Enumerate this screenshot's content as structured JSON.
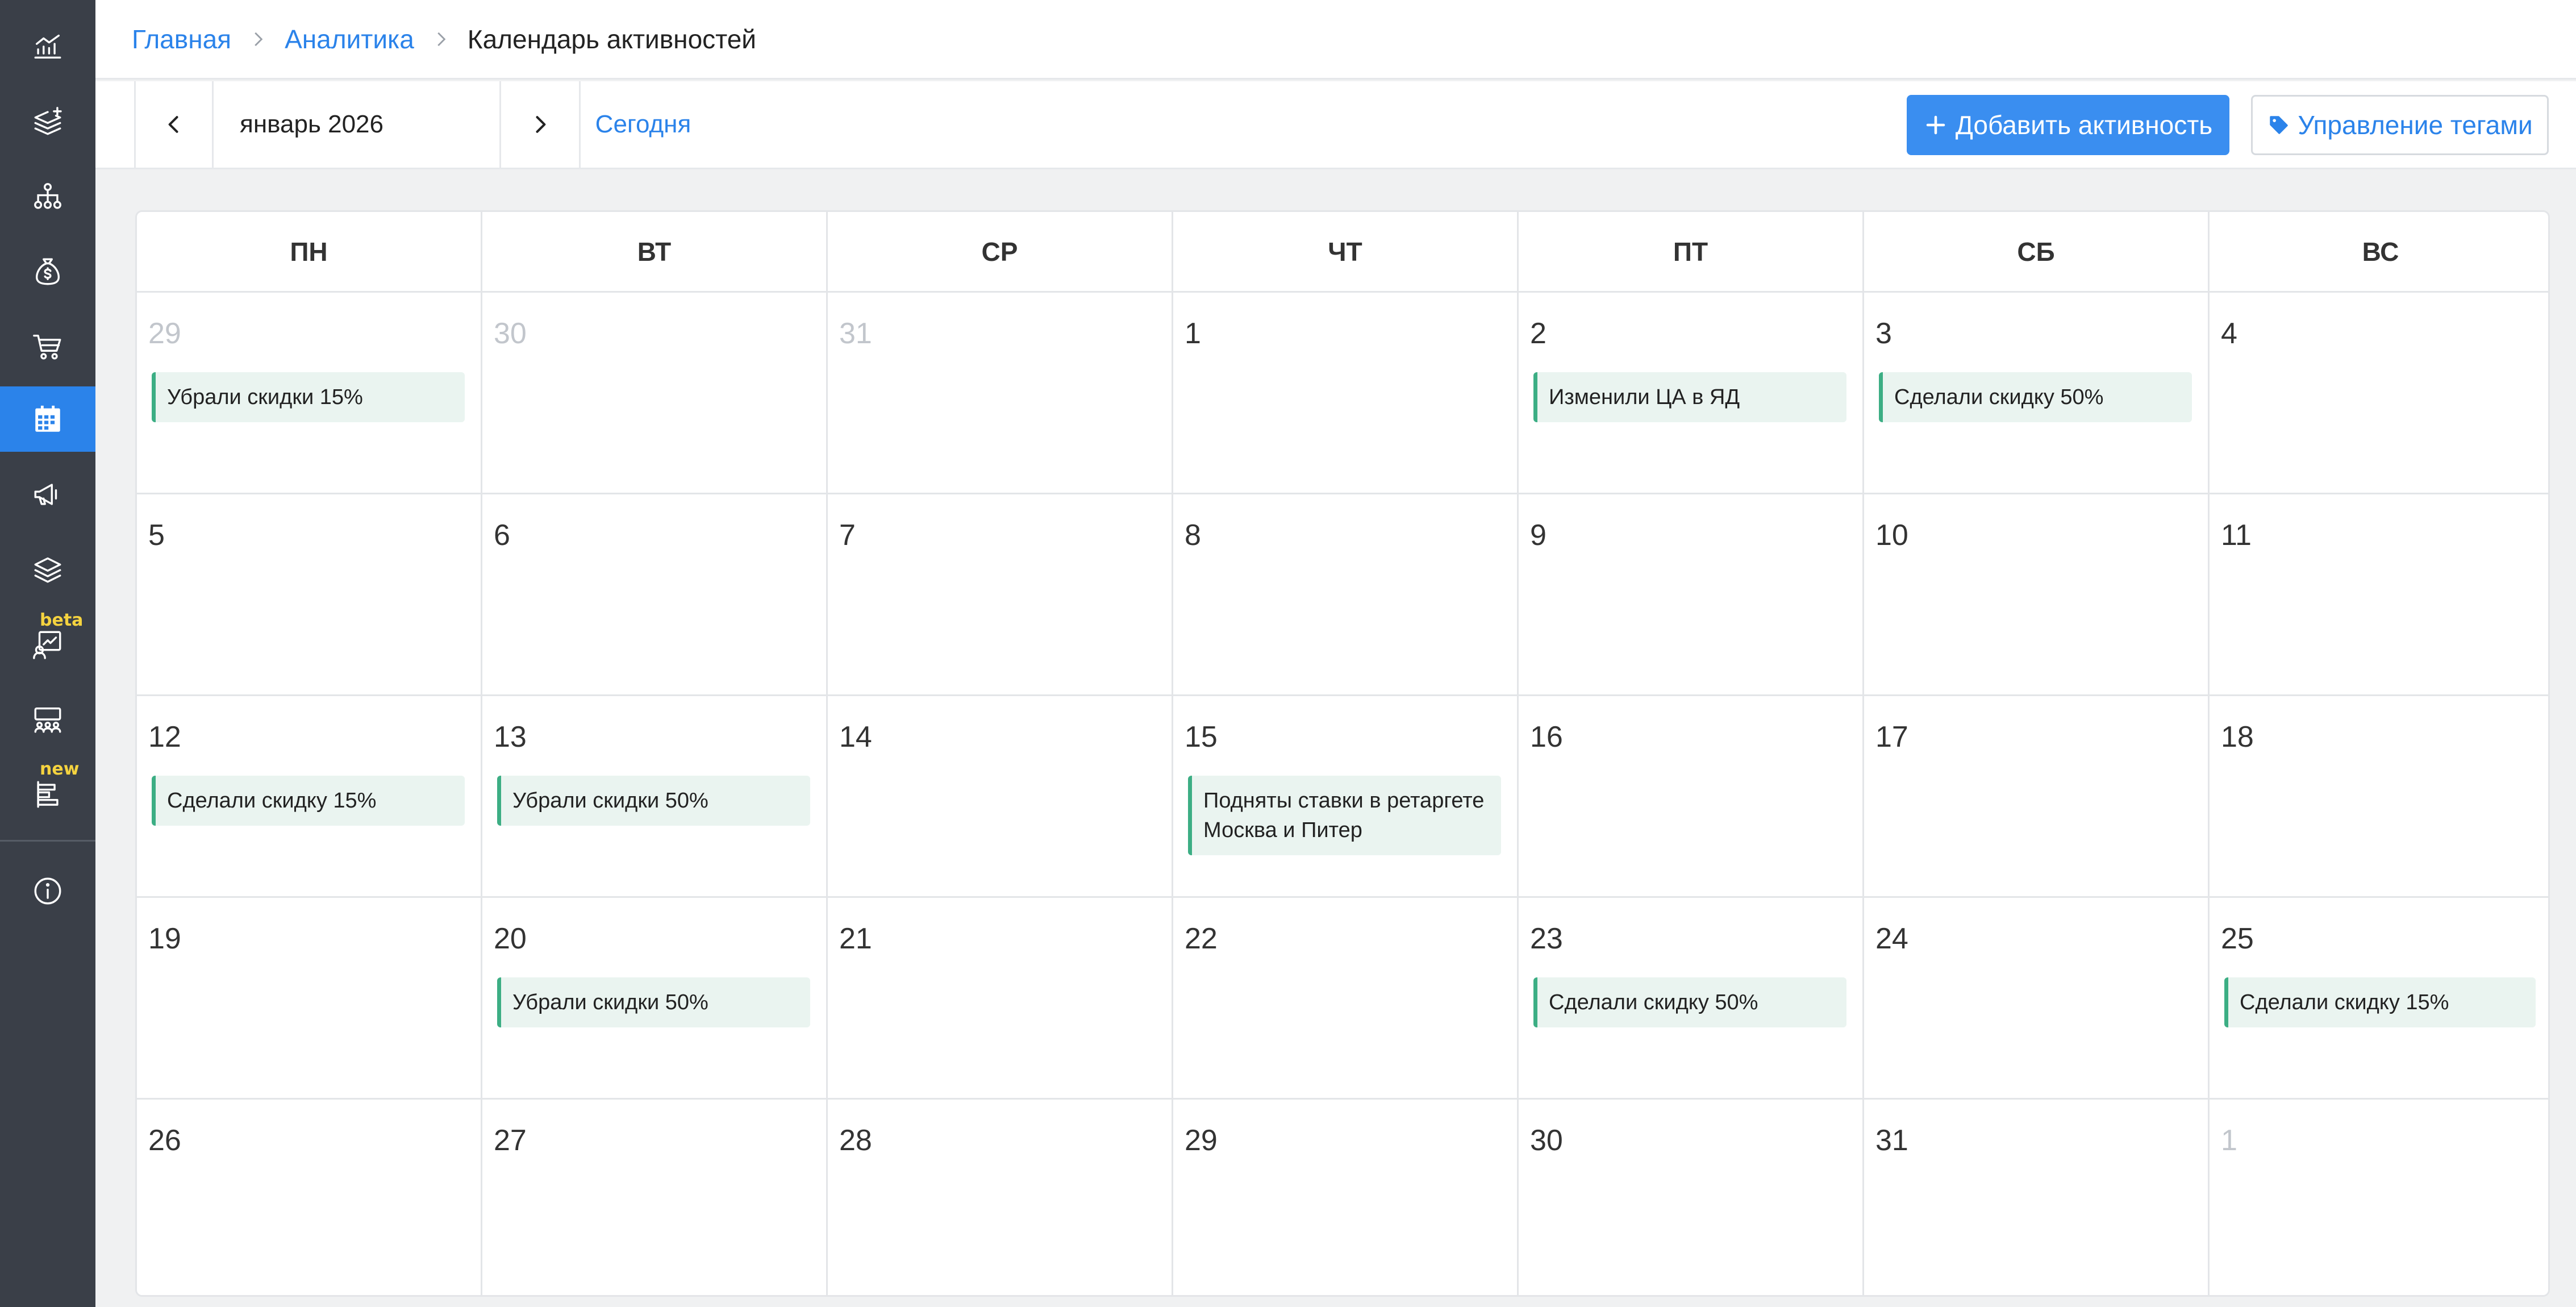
{
  "sidebar": {
    "items": [
      {
        "icon": "analytics-chart-icon",
        "active": false
      },
      {
        "icon": "layers-add-icon",
        "active": false
      },
      {
        "icon": "structure-icon",
        "active": false
      },
      {
        "icon": "money-bag-icon",
        "active": false
      },
      {
        "icon": "shopping-cart-icon",
        "active": false
      },
      {
        "icon": "calendar-icon",
        "active": true
      },
      {
        "icon": "megaphone-icon",
        "active": false
      },
      {
        "icon": "layers-icon",
        "active": false
      },
      {
        "icon": "chart-report-icon",
        "active": false,
        "badge": "beta"
      },
      {
        "icon": "audience-icon",
        "active": false
      },
      {
        "icon": "list-bars-icon",
        "active": false,
        "badge": "new"
      },
      {
        "icon": "info-icon",
        "active": false
      }
    ],
    "accent": "#2b83ea"
  },
  "breadcrumb": {
    "home": "Главная",
    "section": "Аналитика",
    "current": "Календарь активностей"
  },
  "toolbar": {
    "month": "январь 2026",
    "today": "Сегодня",
    "add_button": "Добавить активность",
    "tags_button": "Управление тегами"
  },
  "calendar": {
    "weekdays": [
      "ПН",
      "ВТ",
      "СР",
      "ЧТ",
      "ПТ",
      "СБ",
      "ВС"
    ],
    "weeks": [
      [
        {
          "day": "29",
          "other": true,
          "events": [
            "Убрали скидки 15%"
          ]
        },
        {
          "day": "30",
          "other": true,
          "events": []
        },
        {
          "day": "31",
          "other": true,
          "events": []
        },
        {
          "day": "1",
          "other": false,
          "events": []
        },
        {
          "day": "2",
          "other": false,
          "events": [
            "Изменили ЦА в ЯД"
          ]
        },
        {
          "day": "3",
          "other": false,
          "events": [
            "Сделали скидку 50%"
          ]
        },
        {
          "day": "4",
          "other": false,
          "events": []
        }
      ],
      [
        {
          "day": "5",
          "other": false,
          "events": []
        },
        {
          "day": "6",
          "other": false,
          "events": []
        },
        {
          "day": "7",
          "other": false,
          "events": []
        },
        {
          "day": "8",
          "other": false,
          "events": []
        },
        {
          "day": "9",
          "other": false,
          "events": []
        },
        {
          "day": "10",
          "other": false,
          "events": []
        },
        {
          "day": "11",
          "other": false,
          "events": []
        }
      ],
      [
        {
          "day": "12",
          "other": false,
          "events": [
            "Сделали скидку 15%"
          ]
        },
        {
          "day": "13",
          "other": false,
          "events": [
            "Убрали скидки 50%"
          ]
        },
        {
          "day": "14",
          "other": false,
          "events": []
        },
        {
          "day": "15",
          "other": false,
          "events": [
            "Подняты ставки в ретаргете Москва и Питер"
          ]
        },
        {
          "day": "16",
          "other": false,
          "events": []
        },
        {
          "day": "17",
          "other": false,
          "events": []
        },
        {
          "day": "18",
          "other": false,
          "events": []
        }
      ],
      [
        {
          "day": "19",
          "other": false,
          "events": []
        },
        {
          "day": "20",
          "other": false,
          "events": [
            "Убрали скидки 50%"
          ]
        },
        {
          "day": "21",
          "other": false,
          "events": []
        },
        {
          "day": "22",
          "other": false,
          "events": []
        },
        {
          "day": "23",
          "other": false,
          "events": [
            "Сделали скидку 50%"
          ]
        },
        {
          "day": "24",
          "other": false,
          "events": []
        },
        {
          "day": "25",
          "other": false,
          "events": [
            "Сделали скидку 15%"
          ]
        }
      ],
      [
        {
          "day": "26",
          "other": false,
          "events": []
        },
        {
          "day": "27",
          "other": false,
          "events": []
        },
        {
          "day": "28",
          "other": false,
          "events": []
        },
        {
          "day": "29",
          "other": false,
          "events": []
        },
        {
          "day": "30",
          "other": false,
          "events": []
        },
        {
          "day": "31",
          "other": false,
          "events": []
        },
        {
          "day": "1",
          "other": true,
          "events": []
        }
      ]
    ],
    "event_color": "#3cae84",
    "event_bg": "#eaf4f0"
  }
}
